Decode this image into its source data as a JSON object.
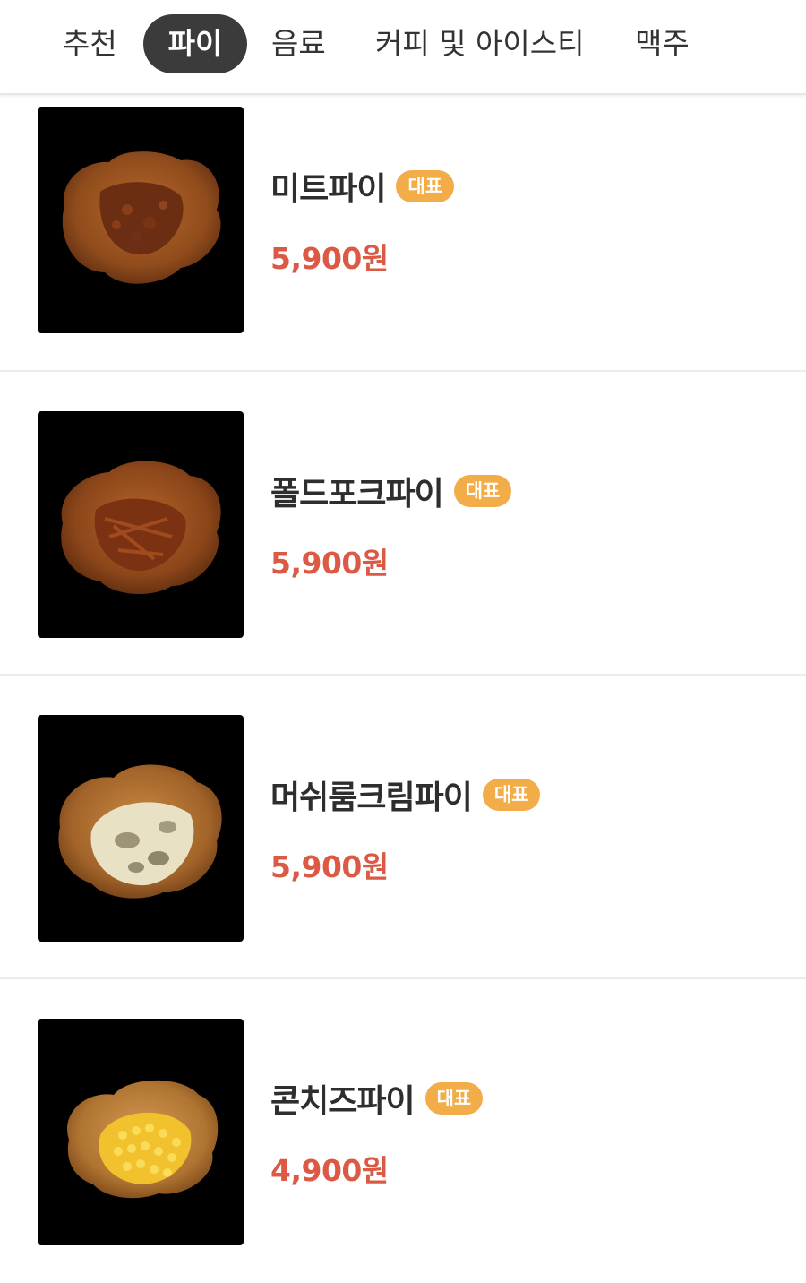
{
  "tabs": [
    {
      "label": "추천",
      "active": false
    },
    {
      "label": "파이",
      "active": true
    },
    {
      "label": "음료",
      "active": false
    },
    {
      "label": "커피 및 아이스티",
      "active": false
    },
    {
      "label": "맥주",
      "active": false
    }
  ],
  "items": [
    {
      "name": "미트파이",
      "badge": "대표",
      "price": "5,900원",
      "image_icon": "meat-pie-icon"
    },
    {
      "name": "폴드포크파이",
      "badge": "대표",
      "price": "5,900원",
      "image_icon": "pulled-pork-pie-icon"
    },
    {
      "name": "머쉬룸크림파이",
      "badge": "대표",
      "price": "5,900원",
      "image_icon": "mushroom-cream-pie-icon"
    },
    {
      "name": "콘치즈파이",
      "badge": "대표",
      "price": "4,900원",
      "image_icon": "corn-cheese-pie-icon"
    }
  ],
  "colors": {
    "active_tab_bg": "#3b3b3b",
    "badge_bg": "#f2ad48",
    "price": "#dc5a45",
    "thumb_bg": "#000000"
  }
}
